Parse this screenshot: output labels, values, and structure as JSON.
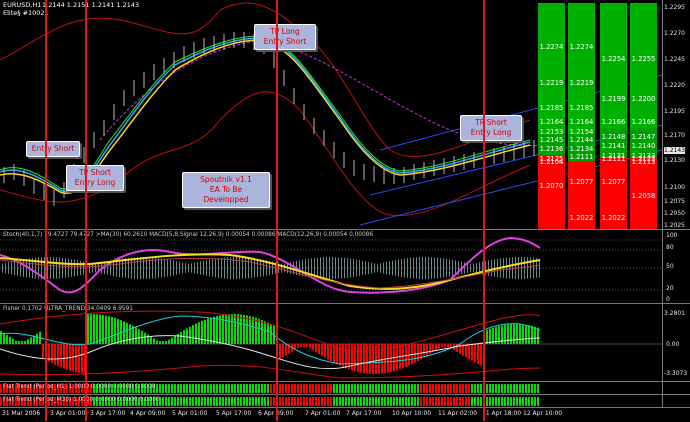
{
  "main": {
    "symbol": "EURUSD,H1",
    "ohlc": "1.2144 1.2151 1.2141 1.2143",
    "sub": "Elite§ #10021",
    "prices": [
      "1.2295",
      "1.2270",
      "1.2245",
      "1.2220",
      "1.2195",
      "1.2170",
      "1.2143",
      "1.2130",
      "1.2100",
      "1.2075",
      "1.2050",
      "1.2025"
    ],
    "current_price": "1.2143",
    "notes": {
      "entry_short": "Entry Short",
      "tp_short_left_1": "TP Short",
      "tp_short_left_2": "Entry Long",
      "tp_long_1": "TP Long",
      "tp_long_2": "Entry Short",
      "tp_short_right_1": "TP Short",
      "tp_short_right_2": "Entry Long",
      "center_1": "Spoutnik v1.1",
      "center_2": "EA To Be",
      "center_3": "Developped"
    },
    "columns": [
      {
        "values": [
          "1.2274",
          "1.2219",
          "1.2185",
          "1.2164",
          "1.2153",
          "1.2145",
          "1.2136",
          "1.2125",
          "1.2104",
          "1.2070"
        ]
      },
      {
        "values": [
          "1.2274",
          "1.2219",
          "1.2185",
          "1.2164",
          "1.2154",
          "1.2144",
          "1.2134",
          "1.2111",
          "1.2077",
          "1.2022"
        ]
      },
      {
        "values": [
          "1.2254",
          "1.2199",
          "1.2166",
          "1.2148",
          "1.2141",
          "1.2131",
          "1.2111",
          "1.2077",
          "1.2022"
        ]
      },
      {
        "values": [
          "1.2255",
          "1.2200",
          "1.2166",
          "1.2147",
          "1.2140",
          "1.2133",
          "1.2123",
          "1.2113",
          "1.2058"
        ]
      }
    ]
  },
  "stoch": {
    "title": "Stoch(40,1,7) 79.4727 79.4727   >MA(30) 60.2610  MACD(5,8,Signal 12,26,9) 0.00054 0.00086  MACD(12,26,9) 0.00054 0.00086",
    "ticks": [
      "100",
      "80",
      "50",
      "20",
      "0"
    ]
  },
  "fisher": {
    "title": "Fisher 0.1702   ULTRA_TREND 34.0409 6.9591",
    "ticks": [
      "3.2801",
      "0.00",
      "-3.3073"
    ]
  },
  "flat1": {
    "title": "Flat Trend (Period_H1) 1.0000 0.0000 0.0000 0.0000"
  },
  "flat2": {
    "title": "Flat Trend (Period_M30) 1.0000 0.0000 0.0000 0.0000"
  },
  "dates": [
    "31 Mar 2006",
    "3 Apr 01:00",
    "3 Apr 17:00",
    "4 Apr 09:00",
    "5 Apr 01:00",
    "5 Apr 17:00",
    "6 Apr 09:00",
    "7 Apr 01:00",
    "7 Apr 17:00",
    "10 Apr 10:00",
    "11 Apr 02:00",
    "11 Apr 18:00",
    "12 Apr 10:00"
  ],
  "colors": {
    "bull": "#00e000",
    "bear": "#ff0000",
    "accent": "#e11717"
  }
}
